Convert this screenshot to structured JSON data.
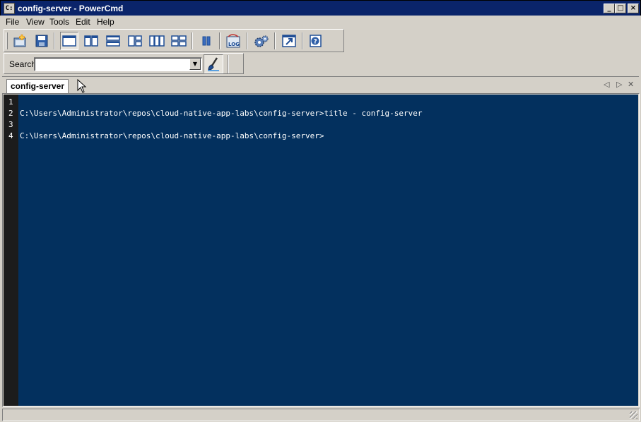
{
  "window": {
    "title": "config-server - PowerCmd",
    "app_icon": "C:",
    "controls": {
      "minimize": "_",
      "maximize": "□",
      "close": "×"
    }
  },
  "menu": [
    "File",
    "View",
    "Tools",
    "Edit",
    "Help"
  ],
  "toolbar": {
    "buttons": [
      {
        "icon": "new-console-icon"
      },
      {
        "icon": "save-icon"
      },
      {
        "icon": "layout-single-icon",
        "active": true
      },
      {
        "icon": "layout-two-columns-icon"
      },
      {
        "icon": "layout-two-rows-icon"
      },
      {
        "icon": "layout-left-split-icon"
      },
      {
        "icon": "layout-three-columns-icon"
      },
      {
        "icon": "layout-four-grid-icon"
      },
      {
        "icon": "pause-icon"
      },
      {
        "icon": "log-icon"
      },
      {
        "icon": "settings-gears-icon"
      },
      {
        "icon": "external-window-icon"
      },
      {
        "icon": "help-icon"
      }
    ]
  },
  "search": {
    "label": "Search",
    "value": "",
    "dropdown_glyph": "▼",
    "highlight_icon": "brush-icon"
  },
  "tabs": [
    {
      "label": "config-server",
      "active": true
    }
  ],
  "tab_nav": {
    "prev": "◁",
    "next": "▷",
    "close": "✕"
  },
  "console": {
    "lines": [
      {
        "n": "1",
        "text": ""
      },
      {
        "n": "2",
        "text": "C:\\Users\\Administrator\\repos\\cloud-native-app-labs\\config-server>title - config-server"
      },
      {
        "n": "3",
        "text": ""
      },
      {
        "n": "4",
        "text": "C:\\Users\\Administrator\\repos\\cloud-native-app-labs\\config-server>"
      }
    ]
  },
  "colors": {
    "console_bg": "#03305e",
    "gutter_bg": "#1c1c1c",
    "titlebar": "#0a246a",
    "chrome": "#d4d0c8"
  }
}
